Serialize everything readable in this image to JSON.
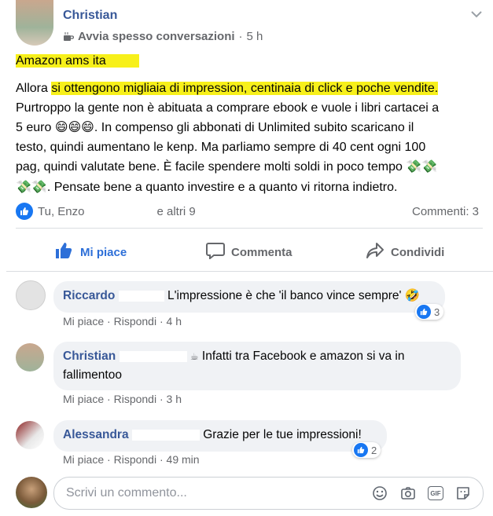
{
  "post": {
    "author": "Christian",
    "group_badge": "Avvia spesso conversazioni",
    "time": "5 h",
    "title": "Amazon ams ita",
    "body": {
      "prefix": "Allora ",
      "highlight": "si ottengono migliaia di impression, centinaia di click e poche vendite.",
      "line2": "Purtroppo la gente non è abituata a comprare ebook e vuole i libri cartacei a",
      "line3_start": "5 euro ",
      "emojis_laugh": "😄😄😄",
      "line3_end": ". In compenso gli abbonati di Unlimited subito scaricano il",
      "line4": "testo, quindi aumentano le kenp. Ma parliamo sempre di 40 cent ogni 100",
      "line5": "pag, quindi valutate bene. È facile spendere molti soldi in poco tempo ",
      "emojis_money_a": "💸💸",
      "emojis_money_b": "💸💸",
      "line6": ". Pensate bene a quanto investire e a quanto vi ritorna indietro."
    },
    "reactions": {
      "by_prefix": "Tu, Enzo",
      "by_suffix": "e altri 9",
      "comments_count": "Commenti: 3"
    },
    "actions": {
      "like": "Mi piace",
      "comment": "Commenta",
      "share": "Condividi"
    }
  },
  "comments": [
    {
      "author": "Riccardo",
      "text": "L'impressione è che 'il banco vince sempre'",
      "emoji": "🤣",
      "like": "Mi piace",
      "reply": "Rispondi",
      "time": "4 h",
      "reactions": "3"
    },
    {
      "author": "Christian",
      "badge_icon": "☕",
      "text_line1": "Infatti tra Facebook e amazon si va in",
      "text_line2": "fallimentoo",
      "like": "Mi piace",
      "reply": "Rispondi",
      "time": "3 h"
    },
    {
      "author": "Alessandra",
      "text": "Grazie per le tue impressioni!",
      "like": "Mi piace",
      "reply": "Rispondi",
      "time": "49 min",
      "reactions": "2"
    }
  ],
  "composer": {
    "placeholder": "Scrivi un commento...",
    "gif_label": "GIF"
  },
  "colors": {
    "link_blue": "#385898",
    "fb_blue": "#1877f2",
    "highlight": "#f7f01a",
    "muted": "#65676b"
  }
}
